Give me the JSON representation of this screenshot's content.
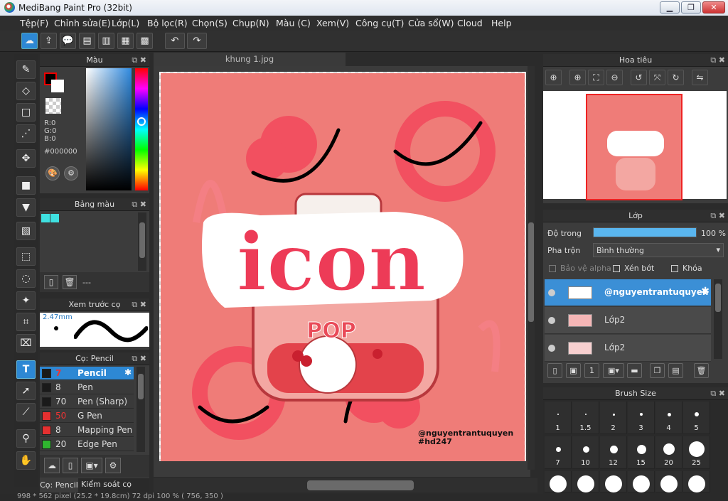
{
  "window": {
    "title": "MediBang Paint Pro (32bit)",
    "min": "▁",
    "max": "❐",
    "close": "✕"
  },
  "menu": [
    "Tệp(F)",
    "Chỉnh sửa(E)",
    "Lớp(L)",
    "Bộ lọc(R)",
    "Chọn(S)",
    "Chụp(N)",
    "Màu (C)",
    "Xem(V)",
    "Công cụ(T)",
    "Cửa sổ(W)",
    "Cloud",
    "Help"
  ],
  "toolbar": {
    "icons": [
      "cloud-icon",
      "upload-icon",
      "speech-bubble-icon",
      "comment-icon",
      "page-icon",
      "panel-layout-icon",
      "grid-icon",
      "undo-icon",
      "redo-icon"
    ]
  },
  "color_panel": {
    "title": "Màu",
    "r": "R:0",
    "g": "G:0",
    "b": "B:0",
    "hex": "#000000"
  },
  "palette_panel": {
    "title": "Bảng màu",
    "name": "---"
  },
  "preview_panel": {
    "title": "Xem trước cọ",
    "size": "2.47mm"
  },
  "brush_panel": {
    "title": "Cọ: Pencil",
    "items": [
      {
        "size": "7",
        "name": "Pencil",
        "color": "#1a1a1a"
      },
      {
        "size": "8",
        "name": "Pen",
        "color": "#1a1a1a"
      },
      {
        "size": "70",
        "name": "Pen (Sharp)",
        "color": "#1a1a1a"
      },
      {
        "size": "50",
        "name": "G Pen",
        "color": "#e53030"
      },
      {
        "size": "8",
        "name": "Mapping Pen",
        "color": "#e53030"
      },
      {
        "size": "20",
        "name": "Edge Pen",
        "color": "#2fb52f"
      }
    ],
    "tab1": "Cọ: Pencil",
    "tab2": "Kiểm soát cọ"
  },
  "document": {
    "tab": "khung 1.jpg",
    "artwork": {
      "big_text": "icon",
      "pop_text": "POP",
      "watermark_line1": "@nguyentrantuquyen",
      "watermark_line2": "#hd247"
    }
  },
  "navigator": {
    "title": "Hoa tiêu"
  },
  "layers_panel": {
    "title": "Lớp",
    "opacity_label": "Độ trong",
    "opacity_value": "100 %",
    "opacity": 1.0,
    "blend_label": "Pha trộn",
    "blend_value": "Bình thường",
    "protect_alpha": "Bảo vệ alpha",
    "clipping": "Xén bớt",
    "lock": "Khóa",
    "layers": [
      {
        "name": "@nguyentrantuquyen",
        "selected": true
      },
      {
        "name": "Lớp2",
        "selected": false
      },
      {
        "name": "Lớp2",
        "selected": false
      }
    ]
  },
  "brush_size_panel": {
    "title": "Brush Size",
    "sizes": [
      "1",
      "1.5",
      "2",
      "3",
      "4",
      "5",
      "7",
      "10",
      "12",
      "15",
      "20",
      "25"
    ]
  },
  "status": "998 * 562 pixel   (25.2 * 19.8cm)   72 dpi   100 %   ( 756, 350 )"
}
